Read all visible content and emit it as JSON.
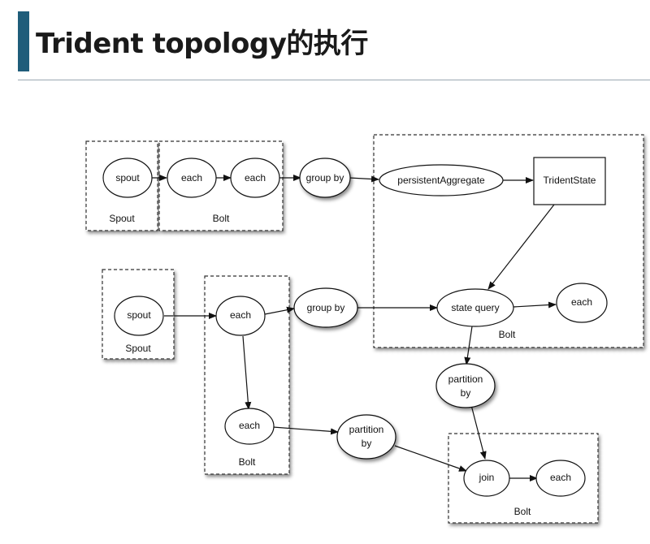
{
  "title": "Trident topology的执行",
  "diagram": {
    "top_row": {
      "spout_node": "spout",
      "spout_box": "Spout",
      "each_1": "each",
      "each_2": "each",
      "bolt_box": "Bolt",
      "group_by": "group by"
    },
    "right_bolt": {
      "persistent_aggregate": "persistentAggregate",
      "trident_state": "TridentState",
      "state_query": "state query",
      "each": "each",
      "bolt_box": "Bolt"
    },
    "middle": {
      "spout_node": "spout",
      "spout_box": "Spout",
      "each_a": "each",
      "each_b": "each",
      "bolt_box": "Bolt",
      "group_by": "group by",
      "partition_by_1_line1": "partition",
      "partition_by_1_line2": "by"
    },
    "bottom": {
      "partition_by_2_line1": "partition",
      "partition_by_2_line2": "by",
      "join": "join",
      "each": "each",
      "bolt_box": "Bolt"
    }
  }
}
